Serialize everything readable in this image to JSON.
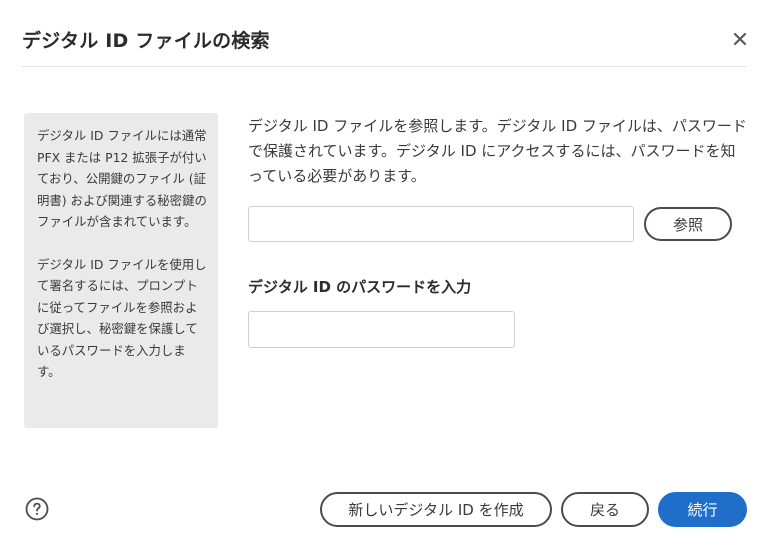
{
  "dialog": {
    "title": "デジタル ID ファイルの検索",
    "close_icon": "close-icon"
  },
  "info_panel": {
    "paragraph1": "デジタル ID ファイルには通常 PFX または P12 拡張子が付いており、公開鍵のファイル (証明書) および関連する秘密鍵のファイルが含まれています。",
    "paragraph2": "デジタル ID ファイルを使用して署名するには、プロンプトに従ってファイルを参照および選択し、秘密鍵を保護しているパスワードを入力します。"
  },
  "main": {
    "description": "デジタル ID ファイルを参照します。デジタル ID ファイルは、パスワードで保護されています。デジタル ID にアクセスするには、パスワードを知っている必要があります。",
    "file_path_value": "",
    "browse_label": "参照",
    "password_label": "デジタル ID のパスワードを入力",
    "password_value": ""
  },
  "footer": {
    "help_icon": "help-icon",
    "create_new_label": "新しいデジタル ID を作成",
    "back_label": "戻る",
    "continue_label": "続行"
  },
  "colors": {
    "primary": "#1f6ec9",
    "panel_bg": "#eaeaea",
    "text": "#2c2c2c"
  }
}
